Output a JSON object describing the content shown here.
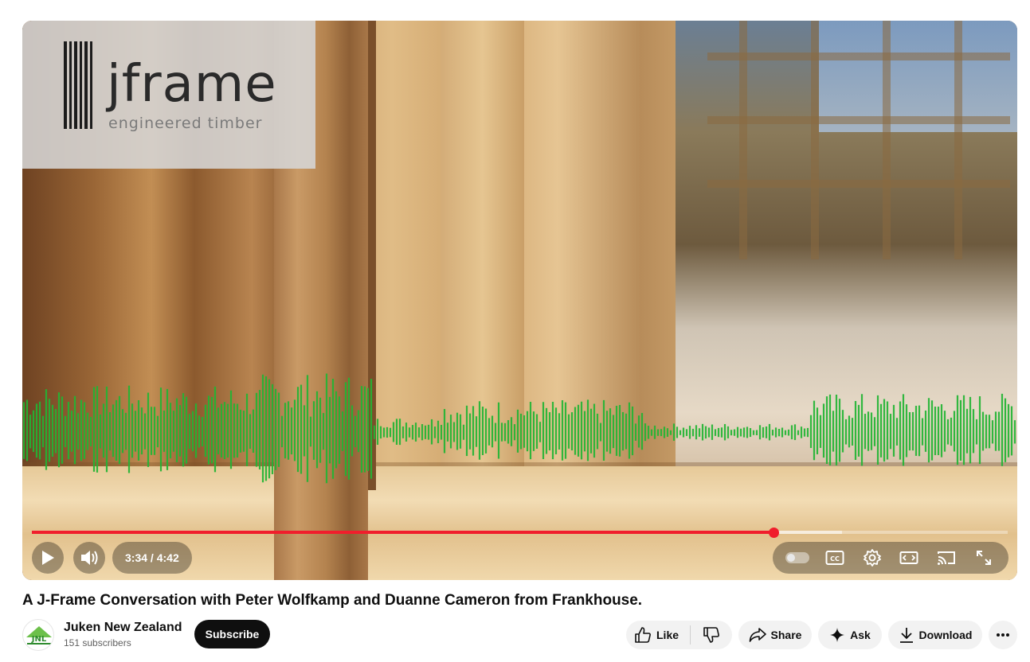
{
  "player": {
    "logo_word": "jframe",
    "logo_sub": "engineered timber",
    "time_current": "3:34",
    "time_separator": " / ",
    "time_total": "4:42",
    "progress_fraction": 0.76,
    "buffer_fraction": 0.83,
    "icons": [
      "play-icon",
      "volume-icon",
      "autoplay-toggle",
      "captions-icon",
      "settings-icon",
      "theater-mode-icon",
      "cast-icon",
      "fullscreen-icon"
    ],
    "accent_color": "#f01e2c",
    "waveform_color": "#22b534"
  },
  "video": {
    "title": "A J-Frame Conversation with Peter Wolfkamp and Duanne Cameron from Frankhouse."
  },
  "channel": {
    "name": "Juken New Zealand",
    "subscribers": "151 subscribers",
    "avatar_text": "JNL",
    "subscribe_label": "Subscribe"
  },
  "actions": {
    "like_label": "Like",
    "share_label": "Share",
    "ask_label": "Ask",
    "download_label": "Download"
  }
}
